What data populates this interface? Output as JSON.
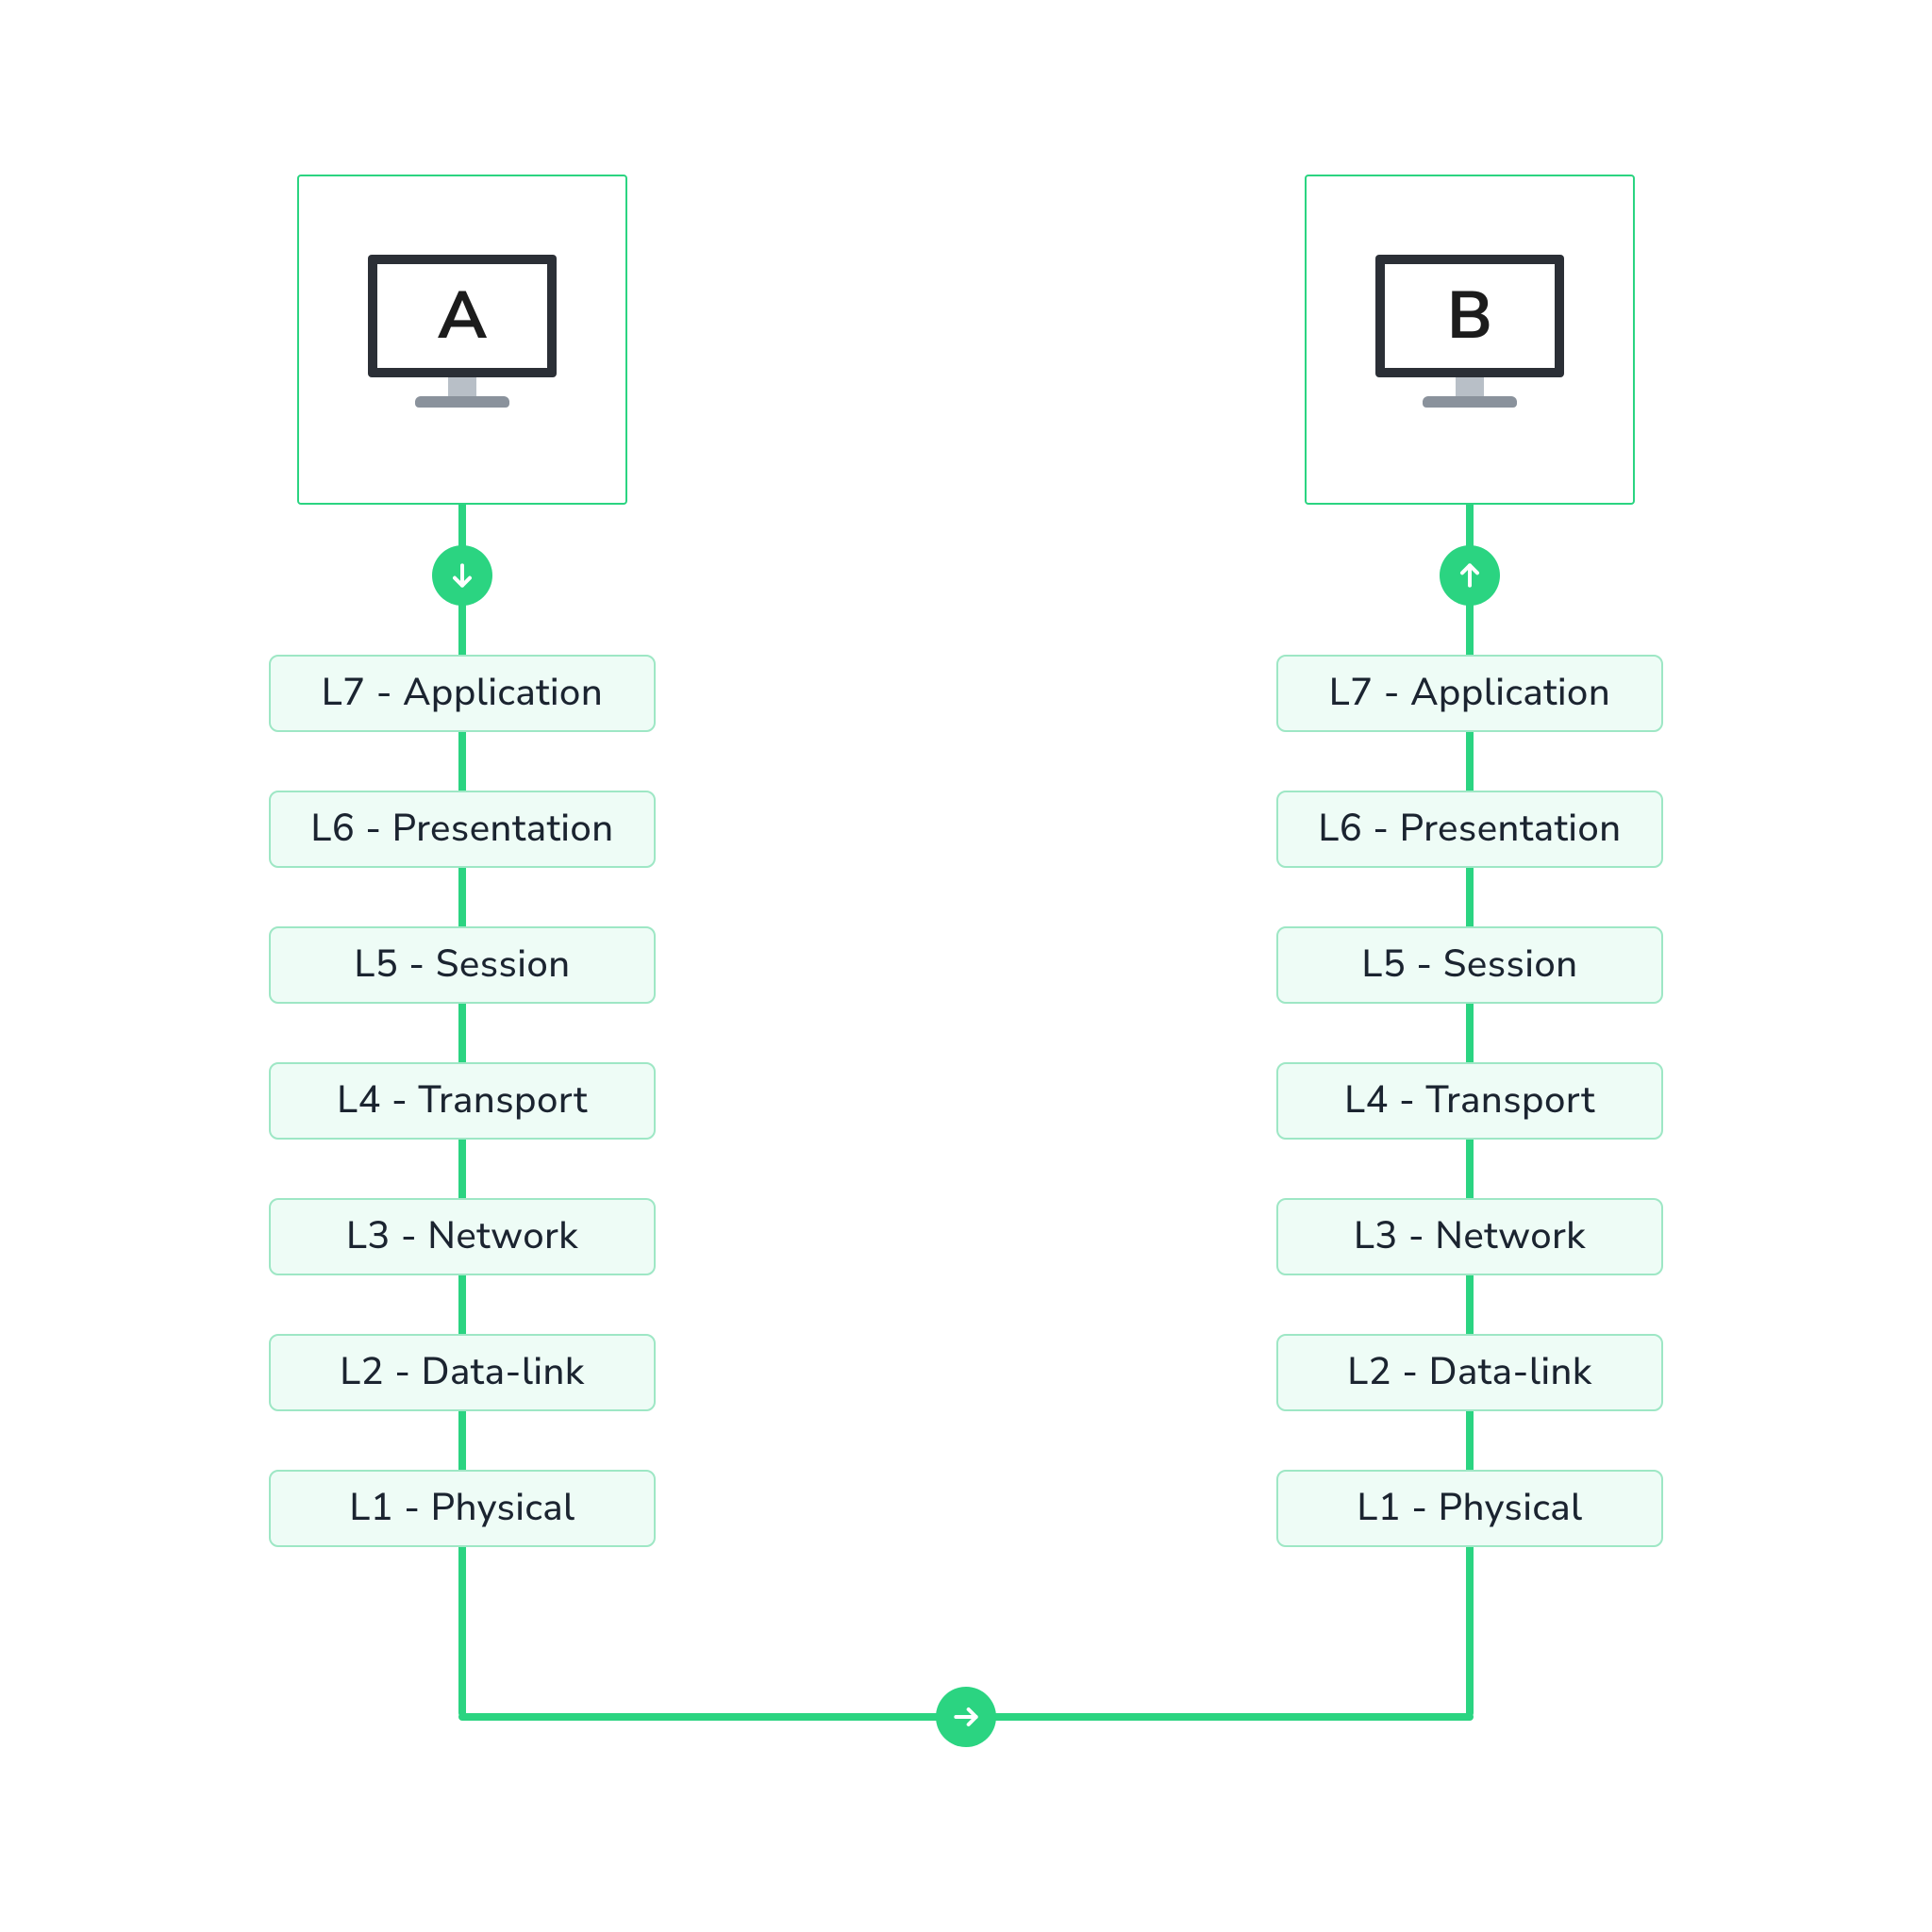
{
  "nodes": {
    "a": {
      "label": "A"
    },
    "b": {
      "label": "B"
    }
  },
  "layers_a": [
    "L7 - Application",
    "L6 - Presentation",
    "L5 - Session",
    "L4 - Transport",
    "L3 - Network",
    "L2 - Data-link",
    "L1 - Physical"
  ],
  "layers_b": [
    "L7 - Application",
    "L6 - Presentation",
    "L5 - Session",
    "L4 - Transport",
    "L3 - Network",
    "L2 - Data-link",
    "L1 - Physical"
  ],
  "arrows": {
    "a": "down",
    "middle": "right",
    "b": "up"
  },
  "colors": {
    "accent": "#2bd481",
    "layer_fill": "#eefcf6",
    "layer_border": "#9ee7c5"
  }
}
